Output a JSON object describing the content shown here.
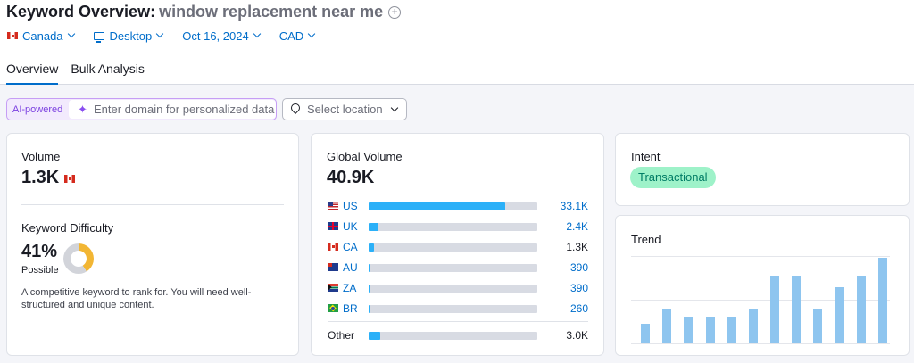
{
  "header": {
    "title": "Keyword Overview:",
    "keyword": "window replacement near me",
    "filters": {
      "country": "Canada",
      "device": "Desktop",
      "date": "Oct 16, 2024",
      "currency": "CAD"
    }
  },
  "tabs": [
    {
      "label": "Overview",
      "active": true
    },
    {
      "label": "Bulk Analysis",
      "active": false
    }
  ],
  "toolbar": {
    "ai_badge": "AI-powered",
    "domain_placeholder": "Enter domain for personalized data",
    "location_placeholder": "Select location"
  },
  "volume": {
    "label": "Volume",
    "value": "1.3K"
  },
  "difficulty": {
    "label": "Keyword Difficulty",
    "value": "41%",
    "percent": 41,
    "rating": "Possible",
    "description": "A competitive keyword to rank for. You will need well-structured and unique content."
  },
  "global_volume": {
    "label": "Global Volume",
    "value": "40.9K",
    "rows": [
      {
        "code": "US",
        "value": "33.1K",
        "share": 0.81,
        "flag": "us"
      },
      {
        "code": "UK",
        "value": "2.4K",
        "share": 0.06,
        "flag": "uk"
      },
      {
        "code": "CA",
        "value": "1.3K",
        "share": 0.03,
        "flag": "ca"
      },
      {
        "code": "AU",
        "value": "390",
        "share": 0.01,
        "flag": "au"
      },
      {
        "code": "ZA",
        "value": "390",
        "share": 0.01,
        "flag": "za"
      },
      {
        "code": "BR",
        "value": "260",
        "share": 0.01,
        "flag": "br"
      }
    ],
    "other": {
      "label": "Other",
      "value": "3.0K",
      "share": 0.07
    }
  },
  "intent": {
    "label": "Intent",
    "badge": "Transactional"
  },
  "trend": {
    "label": "Trend"
  },
  "chart_data": {
    "type": "bar",
    "title": "Trend",
    "values": [
      0.23,
      0.41,
      0.31,
      0.31,
      0.31,
      0.41,
      0.78,
      0.78,
      0.41,
      0.66,
      0.78,
      1.0
    ],
    "ylim": [
      0,
      1
    ],
    "grid": true,
    "color": "#8ec5ef"
  },
  "colors": {
    "accent": "#006dca",
    "bar": "#2bb0f8",
    "intent_bg": "#9ef2c9",
    "difficulty": "#f2b634"
  }
}
